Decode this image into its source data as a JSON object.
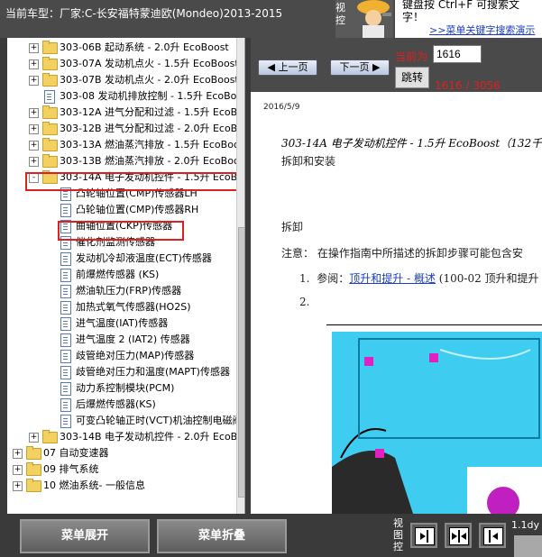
{
  "header": {
    "vehicle_title": "当前车型：厂家:C-长安福特蒙迪欧(Mondeo)2013-2015",
    "mascot_side_text": "视控",
    "hint_line1": "键盘按   Ctrl+F   可搜索文",
    "hint_line2": "字！",
    "hint_link": ">>菜单关键字搜索演示"
  },
  "tree": {
    "items": [
      {
        "label": "303-06B 起动系统 - 2.0升 EcoBoost",
        "type": "folder",
        "expander": "+",
        "level": 1
      },
      {
        "label": "303-07A 发动机点火 - 1.5升 EcoBoost",
        "type": "folder",
        "expander": "+",
        "level": 1
      },
      {
        "label": "303-07B 发动机点火 - 2.0升 EcoBoost",
        "type": "folder",
        "expander": "+",
        "level": 1
      },
      {
        "label": "303-08 发动机排放控制 - 1.5升 EcoBoost",
        "type": "doc",
        "expander": "",
        "level": 1
      },
      {
        "label": "303-12A 进气分配和过滤 - 1.5升 EcoBoost",
        "type": "folder",
        "expander": "+",
        "level": 1
      },
      {
        "label": "303-12B 进气分配和过滤 - 2.0升 EcoBoost",
        "type": "folder",
        "expander": "+",
        "level": 1
      },
      {
        "label": "303-13A 燃油蒸汽排放 - 1.5升 EcoBoost",
        "type": "folder",
        "expander": "+",
        "level": 1
      },
      {
        "label": "303-13B 燃油蒸汽排放 - 2.0升 EcoBoost",
        "type": "folder",
        "expander": "+",
        "level": 1
      },
      {
        "label": "303-14A 电子发动机控件 - 1.5升 EcoBoost",
        "type": "folder",
        "expander": "-",
        "level": 1
      },
      {
        "label": "凸轮轴位置(CMP)传感器LH",
        "type": "doc",
        "expander": "",
        "level": 2
      },
      {
        "label": "凸轮轴位置(CMP)传感器RH",
        "type": "doc",
        "expander": "",
        "level": 2
      },
      {
        "label": "曲轴位置(CKP)传感器",
        "type": "doc",
        "expander": "",
        "level": 2
      },
      {
        "label": "催化剂监测传感器",
        "type": "doc",
        "expander": "",
        "level": 2
      },
      {
        "label": "发动机冷却液温度(ECT)传感器",
        "type": "doc",
        "expander": "",
        "level": 2
      },
      {
        "label": "前爆燃传感器 (KS)",
        "type": "doc",
        "expander": "",
        "level": 2
      },
      {
        "label": "燃油轨压力(FRP)传感器",
        "type": "doc",
        "expander": "",
        "level": 2
      },
      {
        "label": "加热式氧气传感器(HO2S)",
        "type": "doc",
        "expander": "",
        "level": 2
      },
      {
        "label": "进气温度(IAT)传感器",
        "type": "doc",
        "expander": "",
        "level": 2
      },
      {
        "label": "进气温度 2 (IAT2) 传感器",
        "type": "doc",
        "expander": "",
        "level": 2
      },
      {
        "label": "歧管绝对压力(MAP)传感器",
        "type": "doc",
        "expander": "",
        "level": 2
      },
      {
        "label": "歧管绝对压力和温度(MAPT)传感器",
        "type": "doc",
        "expander": "",
        "level": 2
      },
      {
        "label": "动力系控制模块(PCM)",
        "type": "doc",
        "expander": "",
        "level": 2
      },
      {
        "label": "后爆燃传感器(KS)",
        "type": "doc",
        "expander": "",
        "level": 2
      },
      {
        "label": "可变凸轮轴正时(VCT)机油控制电磁阀",
        "type": "doc",
        "expander": "",
        "level": 2
      },
      {
        "label": "303-14B 电子发动机控件 - 2.0升 EcoBoost",
        "type": "folder",
        "expander": "+",
        "level": 1
      },
      {
        "label": "07 自动变速器",
        "type": "folder",
        "expander": "+",
        "level": 0
      },
      {
        "label": "09 排气系统",
        "type": "folder",
        "expander": "+",
        "level": 0
      },
      {
        "label": "10 燃油系统- 一般信息",
        "type": "folder",
        "expander": "+",
        "level": 0
      }
    ]
  },
  "nav": {
    "prev_label": "上一页",
    "next_label": "下一页",
    "current_label": "当前为",
    "page_value": "1616",
    "go_label": "跳转",
    "page_count": "1616 / 3056"
  },
  "document": {
    "date": "2016/5/9",
    "heading": "303-14A 电子发动机控件 - 1.5升 EcoBoost（132千",
    "subheading": "拆卸和安装",
    "section": "拆卸",
    "note": "注意：   在操作指南中所描述的拆卸步骤可能包含安",
    "step1_num": "1.",
    "step1_prefix": "参阅：",
    "step1_link": "顶升和提升 - 概述",
    "step1_suffix": " (100-02 顶升和提升",
    "step2_num": "2."
  },
  "footer": {
    "expand_label": "菜单展开",
    "collapse_label": "菜单折叠",
    "view_label": "视图控",
    "version_text": "1.1dy"
  }
}
